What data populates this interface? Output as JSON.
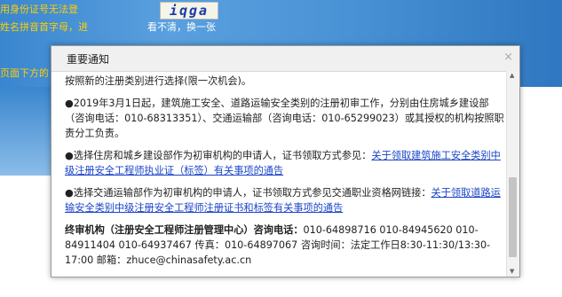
{
  "background": {
    "notice_line1": "用身份证号无法登",
    "notice_line2": "姓名拼音首字母，进",
    "notice_line3": "页面下方的",
    "captcha_text": "iqga",
    "link_text": "看不清，换一张"
  },
  "dialog": {
    "title": "重要通知",
    "close_icon": "×",
    "top_line": "按照新的注册类别进行选择(限一次机会)。",
    "para1": "●2019年3月1日起，建筑施工安全、道路运输安全类别的注册初审工作，分别由住房城乡建设部（咨询电话：010-68313351）、交通运输部（咨询电话：010-65299023）或其授权的机构按照职责分工负责。",
    "para2_text": "●选择住房和城乡建设部作为初审机构的申请人，证书领取方式参见：",
    "para2_link": "关于领取建筑施工安全类别中级注册安全工程师执业证（标签）有关事项的通告",
    "para3_text": "●选择交通运输部作为初审机构的申请人，证书领取方式参见交通职业资格网链接：",
    "para3_link": "关于领取道路运输安全类别中级注册安全工程师注册证书和标签有关事项的通告",
    "para4_bold": "终审机构（注册安全工程师注册管理中心）咨询电话：",
    "para4_text": "010-64898716 010-84945620 010-84911404 010-64937467 传真：010-64897067 咨询时间：法定工作日8:30-11:30/13:30-17:00 邮箱：zhuce@chinasafety.ac.cn"
  },
  "colors": {
    "link": "#1a44c8",
    "background_blue": "#3a86cf",
    "notice_yellow": "#ffd000"
  }
}
